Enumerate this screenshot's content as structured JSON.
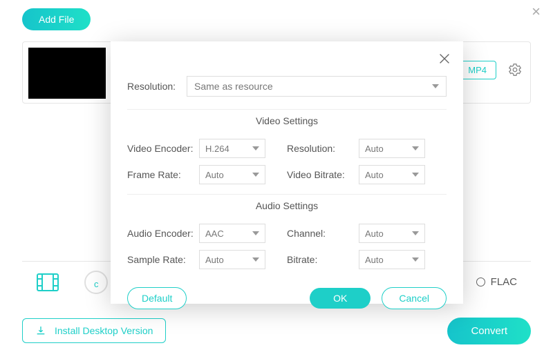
{
  "toolbar": {
    "add_file": "Add File"
  },
  "file": {
    "format_badge": "MP4"
  },
  "format_bar": {
    "flac_label": "FLAC",
    "partial_letter": "c"
  },
  "footer": {
    "install": "Install Desktop Version",
    "convert": "Convert"
  },
  "modal": {
    "resolution_label": "Resolution:",
    "resolution_value": "Same as resource",
    "video_header": "Video Settings",
    "audio_header": "Audio Settings",
    "video": {
      "encoder_label": "Video Encoder:",
      "encoder_value": "H.264",
      "resolution_label": "Resolution:",
      "resolution_value": "Auto",
      "framerate_label": "Frame Rate:",
      "framerate_value": "Auto",
      "bitrate_label": "Video Bitrate:",
      "bitrate_value": "Auto"
    },
    "audio": {
      "encoder_label": "Audio Encoder:",
      "encoder_value": "AAC",
      "channel_label": "Channel:",
      "channel_value": "Auto",
      "samplerate_label": "Sample Rate:",
      "samplerate_value": "Auto",
      "bitrate_label": "Bitrate:",
      "bitrate_value": "Auto"
    },
    "buttons": {
      "default": "Default",
      "ok": "OK",
      "cancel": "Cancel"
    }
  }
}
